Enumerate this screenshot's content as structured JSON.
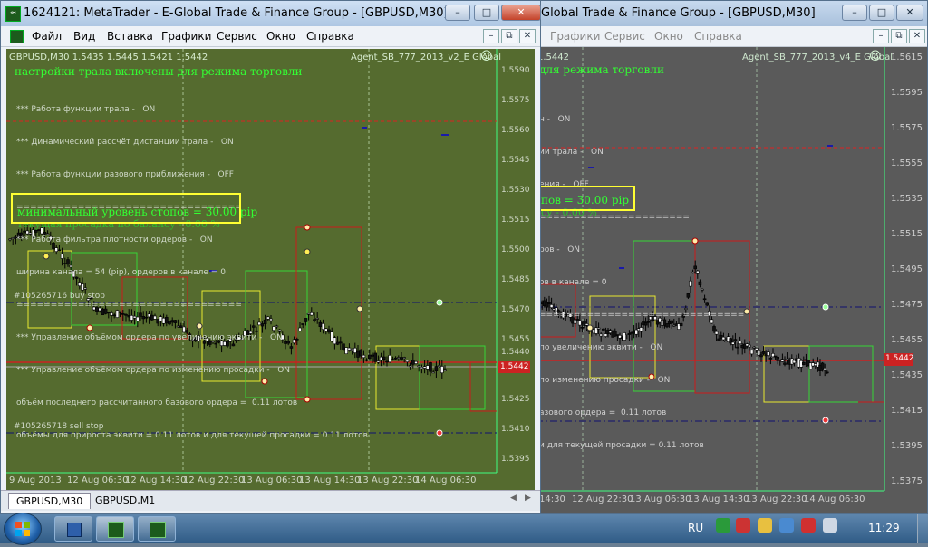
{
  "left_window": {
    "title": "1624121: MetaTrader - E-Global Trade & Finance Group - [GBPUSD,M30]",
    "menu": [
      "Файл",
      "Вид",
      "Вставка",
      "Графики",
      "Сервис",
      "Окно",
      "Справка"
    ],
    "chart_header": "GBPUSD,M30  1.5435 1.5445 1.5421 1.5442",
    "expert_label": "Agent_SB_777_2013_v2_E Global",
    "info_title": "настройки трала включены для режима  торговли",
    "info_lines": [
      "*** Работа функции трала -   ON",
      "*** Динамический рассчёт дистанции трала -   ON",
      "*** Работа функции разового приближения -   OFF",
      "=================================",
      "*** Работа фильтра плотности ордеров -   ON",
      "ширина канала = 54 (pip), ордеров в канале = 0",
      "=================================",
      "*** Управление объёмом ордера по увеличению эквити -   ON",
      "*** Управление объёмом ордера по изменению просадки -   ON",
      "объём последнего рассчитанного базового ордера =  0.11 лотов",
      "объёмы для прироста эквити = 0.11 лотов и для текущей просадки = 0.11 лотов"
    ],
    "stop_text": "минимальный уровень стопов =  30.00 pip",
    "overlap_text": "текущая просадка по балансу -  0.00 %",
    "order_buy": "#105265716 buy stop",
    "order_sell": "#105265718 sell stop",
    "price_labels": [
      "1.5590",
      "1.5575",
      "1.5560",
      "1.5545",
      "1.5530",
      "1.5515",
      "1.5500",
      "1.5485",
      "1.5470",
      "1.5455",
      "1.5440",
      "1.5425",
      "1.5410",
      "1.5395"
    ],
    "current_price": "1.5442",
    "time_labels": [
      "9 Aug 2013",
      "12 Aug 06:30",
      "12 Aug 14:30",
      "12 Aug 22:30",
      "13 Aug 06:30",
      "13 Aug 14:30",
      "13 Aug 22:30",
      "14 Aug 06:30"
    ],
    "tabs": [
      "GBPUSD,M30",
      "GBPUSD,M1"
    ],
    "colors": {
      "background": "#556b2f",
      "text": "#bfe3bf",
      "title_text": "#33ff33"
    }
  },
  "right_window": {
    "title": "Global Trade & Finance Group - [GBPUSD,M30]",
    "menu": [
      "Графики",
      "Сервис",
      "Окно",
      "Справка"
    ],
    "chart_header": "1.5442",
    "expert_label": "Agent_SB_777_2013_v4_E Global",
    "info_title": "для режима  торговли",
    "info_lines": [
      "н -   ON",
      "ии трала -   ON",
      "ения -   OFF",
      "======================",
      "ров -   ON",
      "ов в канале = 0",
      "==============================",
      "по увеличению эквити -   ON",
      "по изменению просадки -   ON",
      "азового ордера =  0.11 лотов",
      "и для текущей просадки = 0.11 лотов"
    ],
    "stop_text": "пов =  30.00 pip",
    "overlap_text": "су -  0.00 %",
    "price_labels": [
      "1.5615",
      "1.5595",
      "1.5575",
      "1.5555",
      "1.5535",
      "1.5515",
      "1.5495",
      "1.5475",
      "1.5455",
      "1.5435",
      "1.5415",
      "1.5395",
      "1.5375"
    ],
    "current_price": "1.5442",
    "time_labels": [
      "14:30",
      "12 Aug 22:30",
      "13 Aug 06:30",
      "13 Aug 14:30",
      "13 Aug 22:30",
      "14 Aug 06:30"
    ],
    "colors": {
      "background": "#5a5a5a"
    }
  },
  "taskbar": {
    "language": "RU",
    "clock": "11:29"
  }
}
